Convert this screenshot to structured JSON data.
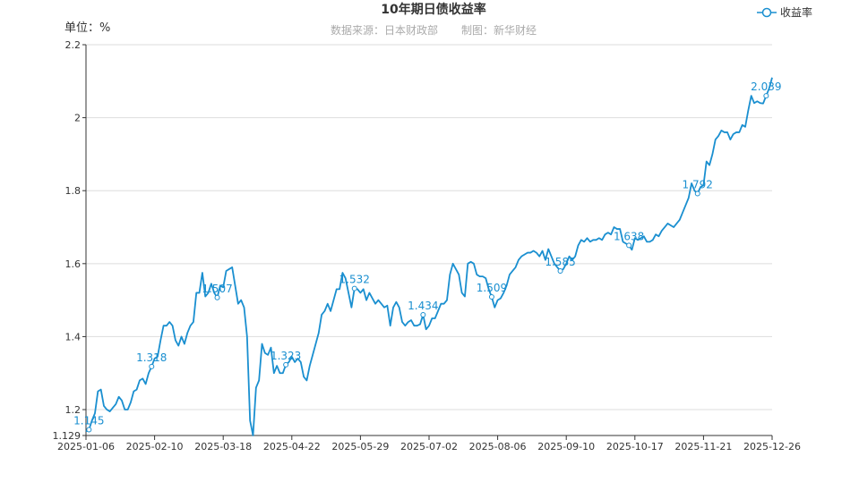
{
  "chart_data": {
    "type": "line",
    "title": "10年期日债收益率",
    "subtitle_source": "数据来源：日本财政部",
    "subtitle_maker": "制图：新华财经",
    "unit_label": "单位：%",
    "ylim": [
      1.129,
      2.2
    ],
    "y_ticks": [
      "1.129",
      "1.2",
      "1.4",
      "1.6",
      "1.8",
      "2",
      "2.2"
    ],
    "y_tick_values": [
      1.129,
      1.2,
      1.4,
      1.6,
      1.8,
      2.0,
      2.2
    ],
    "x_tick_labels": [
      "2025-01-06",
      "2025-02-10",
      "2025-03-18",
      "2025-04-22",
      "2025-05-29",
      "2025-07-02",
      "2025-08-06",
      "2025-09-10",
      "2025-10-17",
      "2025-11-21",
      "2025-12-26"
    ],
    "grid": true,
    "legend_position": "top-right",
    "series": [
      {
        "name": "收益率",
        "color": "#1a8fd0",
        "values": [
          1.14,
          1.145,
          1.17,
          1.19,
          1.25,
          1.255,
          1.21,
          1.2,
          1.195,
          1.205,
          1.215,
          1.235,
          1.225,
          1.2,
          1.2,
          1.22,
          1.25,
          1.255,
          1.28,
          1.285,
          1.27,
          1.3,
          1.318,
          1.34,
          1.345,
          1.39,
          1.43,
          1.43,
          1.44,
          1.43,
          1.39,
          1.375,
          1.4,
          1.38,
          1.41,
          1.43,
          1.44,
          1.52,
          1.52,
          1.575,
          1.51,
          1.52,
          1.545,
          1.52,
          1.507,
          1.54,
          1.535,
          1.58,
          1.585,
          1.59,
          1.54,
          1.49,
          1.5,
          1.48,
          1.4,
          1.17,
          1.129,
          1.26,
          1.28,
          1.38,
          1.355,
          1.35,
          1.37,
          1.3,
          1.32,
          1.3,
          1.3,
          1.323,
          1.33,
          1.345,
          1.33,
          1.34,
          1.33,
          1.29,
          1.28,
          1.32,
          1.35,
          1.38,
          1.41,
          1.46,
          1.47,
          1.49,
          1.47,
          1.5,
          1.53,
          1.53,
          1.575,
          1.56,
          1.52,
          1.48,
          1.532,
          1.53,
          1.52,
          1.53,
          1.5,
          1.52,
          1.505,
          1.49,
          1.5,
          1.49,
          1.48,
          1.485,
          1.43,
          1.48,
          1.495,
          1.48,
          1.44,
          1.43,
          1.44,
          1.445,
          1.43,
          1.43,
          1.434,
          1.46,
          1.42,
          1.43,
          1.45,
          1.45,
          1.47,
          1.49,
          1.49,
          1.5,
          1.57,
          1.6,
          1.585,
          1.57,
          1.52,
          1.51,
          1.6,
          1.605,
          1.6,
          1.57,
          1.565,
          1.565,
          1.56,
          1.53,
          1.509,
          1.48,
          1.5,
          1.505,
          1.52,
          1.54,
          1.57,
          1.58,
          1.59,
          1.61,
          1.62,
          1.625,
          1.63,
          1.63,
          1.635,
          1.63,
          1.62,
          1.635,
          1.61,
          1.64,
          1.62,
          1.6,
          1.59,
          1.58,
          1.585,
          1.6,
          1.62,
          1.61,
          1.62,
          1.65,
          1.665,
          1.66,
          1.67,
          1.66,
          1.665,
          1.665,
          1.67,
          1.665,
          1.68,
          1.685,
          1.68,
          1.7,
          1.695,
          1.695,
          1.66,
          1.655,
          1.65,
          1.638,
          1.67,
          1.665,
          1.67,
          1.675,
          1.66,
          1.66,
          1.665,
          1.68,
          1.675,
          1.69,
          1.7,
          1.71,
          1.705,
          1.7,
          1.71,
          1.72,
          1.74,
          1.76,
          1.78,
          1.82,
          1.8,
          1.792,
          1.81,
          1.815,
          1.88,
          1.87,
          1.9,
          1.94,
          1.95,
          1.965,
          1.96,
          1.96,
          1.94,
          1.955,
          1.96,
          1.96,
          1.98,
          1.975,
          2.02,
          2.06,
          2.04,
          2.045,
          2.04,
          2.039,
          2.06,
          2.08,
          2.11
        ]
      }
    ],
    "data_labels": [
      {
        "index": 1,
        "text": "1.145"
      },
      {
        "index": 22,
        "text": "1.318"
      },
      {
        "index": 44,
        "text": "1.507"
      },
      {
        "index": 67,
        "text": "1.323"
      },
      {
        "index": 90,
        "text": "1.532"
      },
      {
        "index": 113,
        "text": "1.434"
      },
      {
        "index": 136,
        "text": "1.509"
      },
      {
        "index": 159,
        "text": "1.585"
      },
      {
        "index": 182,
        "text": "1.638"
      },
      {
        "index": 205,
        "text": "1.792"
      },
      {
        "index": 228,
        "text": "2.039"
      }
    ]
  }
}
